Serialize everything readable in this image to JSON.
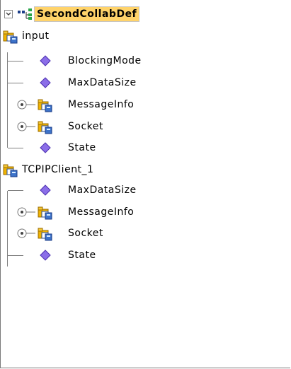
{
  "tree": {
    "root": {
      "label": "SecondCollabDef",
      "expanded": true,
      "selected": true
    },
    "nodes": [
      {
        "label": "input",
        "type": "folder",
        "expanded": true,
        "children": [
          {
            "label": "BlockingMode",
            "type": "field"
          },
          {
            "label": "MaxDataSize",
            "type": "field"
          },
          {
            "label": "MessageInfo",
            "type": "folder",
            "expanded": false
          },
          {
            "label": "Socket",
            "type": "folder",
            "expanded": false
          },
          {
            "label": "State",
            "type": "field"
          }
        ]
      },
      {
        "label": "TCPIPClient_1",
        "type": "folder",
        "expanded": true,
        "children": [
          {
            "label": "MaxDataSize",
            "type": "field"
          },
          {
            "label": "MessageInfo",
            "type": "folder",
            "expanded": false
          },
          {
            "label": "Socket",
            "type": "folder",
            "expanded": false
          },
          {
            "label": "State",
            "type": "field"
          }
        ]
      }
    ]
  },
  "colors": {
    "selection_bg": "#ffd36a",
    "field_icon": "#8b6ee8",
    "folder_icon": "#f0b300",
    "grid_line": "#7f7f7f"
  }
}
